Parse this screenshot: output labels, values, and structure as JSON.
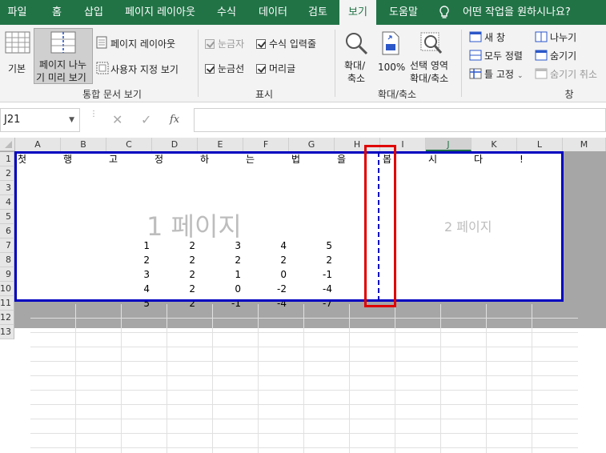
{
  "menu": {
    "tabs": [
      "파일",
      "홈",
      "삽입",
      "페이지 레이아웃",
      "수식",
      "데이터",
      "검토",
      "보기",
      "도움말"
    ],
    "tell_me": "어떤 작업을 원하시나요?"
  },
  "ribbon": {
    "workbook_views": {
      "normal": "기본",
      "page_break_line1": "페이지 나누",
      "page_break_line2": "기 미리 보기",
      "page_layout": "페이지 레이아웃",
      "custom_views": "사용자 지정 보기",
      "group_label": "통합 문서 보기"
    },
    "show": {
      "ruler": "눈금자",
      "formula_bar": "수식 입력줄",
      "gridlines": "눈금선",
      "headings": "머리글",
      "group_label": "표시"
    },
    "zoom": {
      "zoom_line1": "확대/",
      "zoom_line2": "축소",
      "hundred": "100%",
      "to_sel_line1": "선택 영역",
      "to_sel_line2": "확대/축소",
      "group_label": "확대/축소"
    },
    "window": {
      "new_window": "새 창",
      "arrange_all": "모두 정렬",
      "freeze": "틀 고정",
      "split": "나누기",
      "hide": "숨기기",
      "unhide": "숨기기 취소",
      "group_label": "창"
    }
  },
  "formula": {
    "name_box": "J21",
    "fx": "fx"
  },
  "sheet": {
    "columns": [
      "A",
      "B",
      "C",
      "D",
      "E",
      "F",
      "G",
      "H",
      "I",
      "J",
      "K",
      "L",
      "M"
    ],
    "rows": [
      "1",
      "2",
      "3",
      "4",
      "5",
      "6",
      "7",
      "8",
      "9",
      "10",
      "11",
      "12",
      "13"
    ],
    "row1": [
      "첫",
      "행",
      "고",
      "정",
      "하",
      "는",
      "법",
      "을",
      "봅",
      "시",
      "다",
      "!"
    ],
    "numbers": [
      [
        "1",
        "2",
        "3",
        "4",
        "5"
      ],
      [
        "2",
        "2",
        "2",
        "2",
        "2"
      ],
      [
        "3",
        "2",
        "1",
        "0",
        "-1"
      ],
      [
        "4",
        "2",
        "0",
        "-2",
        "-4"
      ],
      [
        "5",
        "2",
        "-1",
        "-4",
        "-7"
      ]
    ],
    "page1_label": "1 페이지",
    "page2_label": "2 페이지"
  },
  "colors": {
    "brand": "#217346",
    "page_border": "#0000c0",
    "highlight": "#e00000"
  }
}
